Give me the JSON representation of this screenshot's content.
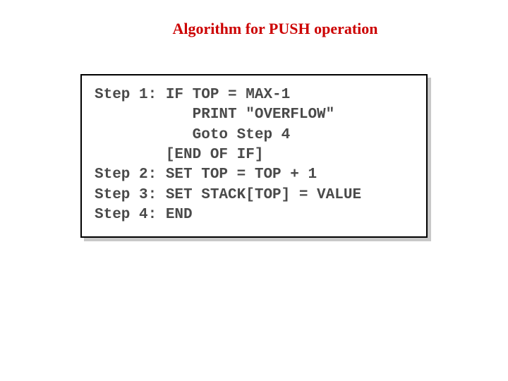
{
  "title": "Algorithm for PUSH operation",
  "steps": [
    {
      "label": "Step 1:",
      "body": " IF TOP = MAX-1"
    },
    {
      "label": "",
      "body": "           PRINT \"OVERFLOW\""
    },
    {
      "label": "",
      "body": "           Goto Step 4"
    },
    {
      "label": "",
      "body": "        [END OF IF]"
    },
    {
      "label": "Step 2:",
      "body": " SET TOP = TOP + 1"
    },
    {
      "label": "Step 3:",
      "body": " SET STACK[TOP] = VALUE"
    },
    {
      "label": "Step 4:",
      "body": " END"
    }
  ]
}
